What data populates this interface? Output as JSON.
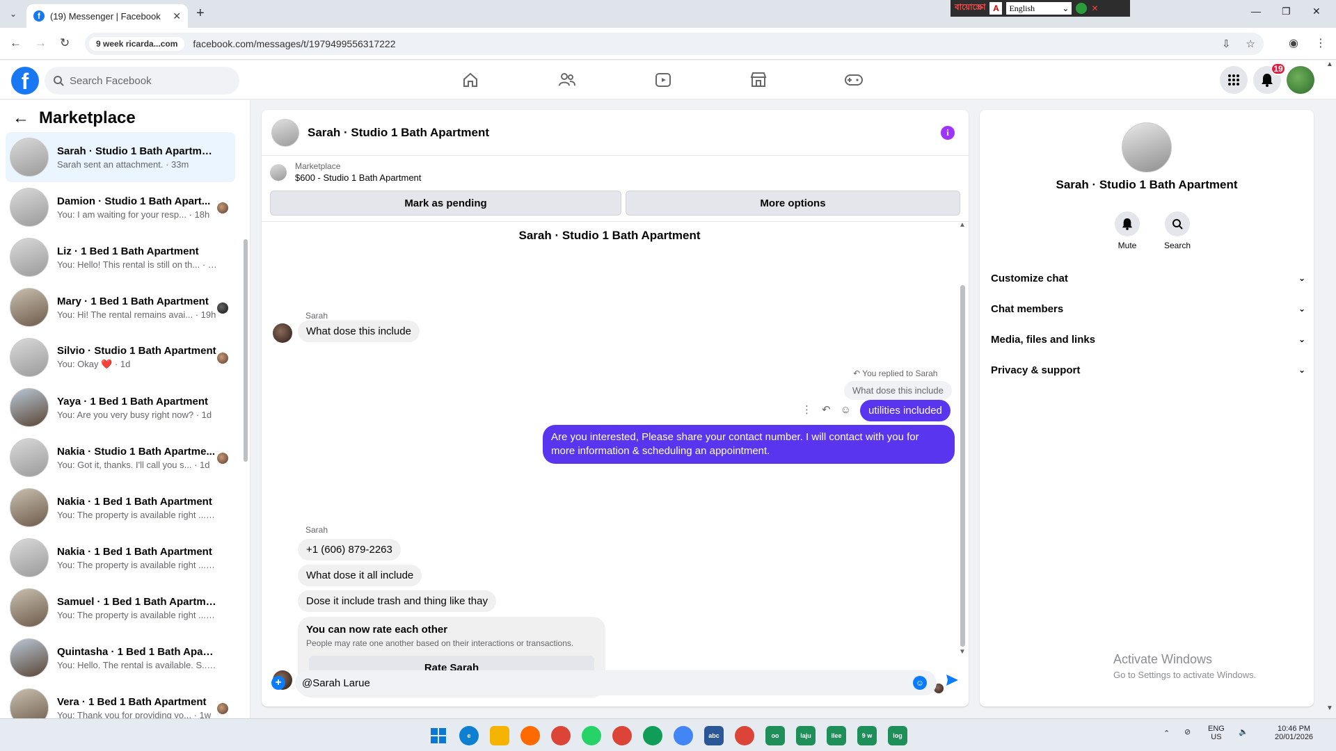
{
  "browser": {
    "tab_title": "(19) Messenger | Facebook",
    "site_chip": "9 week ricarda...com",
    "url": "facebook.com/messages/t/1979499556317222",
    "lang_bn": "বায়োস্ক্রো",
    "lang_select": "English"
  },
  "fb": {
    "search_placeholder": "Search Facebook",
    "notif_count": "19"
  },
  "left": {
    "title": "Marketplace",
    "conversations": [
      {
        "name": "Sarah · Studio 1 Bath Apartment",
        "preview": "Sarah sent an attachment. · 33m"
      },
      {
        "name": "Damion · Studio 1 Bath Apart...",
        "preview": "You: I am waiting for your resp... · 18h"
      },
      {
        "name": "Liz · 1 Bed 1 Bath Apartment",
        "preview": "You: Hello! This rental is still on th... · 19h"
      },
      {
        "name": "Mary · 1 Bed 1 Bath Apartment",
        "preview": "You: Hi! The rental remains avai... · 19h"
      },
      {
        "name": "Silvio · Studio 1 Bath Apartment",
        "preview": "You: Okay ❤️ · 1d"
      },
      {
        "name": "Yaya · 1 Bed 1 Bath Apartment",
        "preview": "You: Are you very busy right now? · 1d"
      },
      {
        "name": "Nakia · Studio 1 Bath Apartme...",
        "preview": "You: Got it, thanks. I'll call you s... · 1d"
      },
      {
        "name": "Nakia · 1 Bed 1 Bath Apartment",
        "preview": "You: The property is available right ... · 1d"
      },
      {
        "name": "Nakia · 1 Bed 1 Bath Apartment",
        "preview": "You: The property is available right ... · 1d"
      },
      {
        "name": "Samuel · 1 Bed 1 Bath Apartment",
        "preview": "You: The property is available right ... · 3d"
      },
      {
        "name": "Quintasha · 1 Bed 1 Bath Apartm...",
        "preview": "You: Hello. The rental is available. S... · 6d"
      },
      {
        "name": "Vera · 1 Bed 1 Bath Apartment",
        "preview": "You: Thank you for providing yo... · 1w"
      }
    ]
  },
  "chat": {
    "title": "Sarah · Studio 1 Bath Apartment",
    "marketplace_label": "Marketplace",
    "listing": "$600 - Studio 1 Bath Apartment",
    "mark_pending": "Mark as pending",
    "more_options": "More options",
    "top_name": "Sarah · Studio 1 Bath Apartment",
    "sender1": "Sarah",
    "msg1": "What dose this include",
    "replied_label": "You replied to Sarah",
    "quoted": "What dose this include",
    "my_reply": "utilities included",
    "my_msg2_line1": "Are you interested, Please share your contact number. I will contact with you for",
    "my_msg2_line2": "more information & scheduling an appointment.",
    "sender2": "Sarah",
    "msg_phone": "+1 (606) 879-2263",
    "msg_include": "What dose it all include",
    "msg_trash": "Dose it include trash and thing like thay",
    "rate_title": "You can now rate each other",
    "rate_sub": "People may rate one another based on their interactions or transactions.",
    "rate_btn": "Rate Sarah",
    "composer_value": "@Sarah Larue"
  },
  "right": {
    "name": "Sarah · Studio 1 Bath Apartment",
    "mute": "Mute",
    "search": "Search",
    "rows": [
      "Customize chat",
      "Chat members",
      "Media, files and links",
      "Privacy & support"
    ]
  },
  "watermark": {
    "line1": "Activate Windows",
    "line2": "Go to Settings to activate Windows."
  },
  "taskbar": {
    "lang1": "ENG",
    "lang2": "US",
    "time": "10:46 PM",
    "date": "20/01/2026"
  }
}
